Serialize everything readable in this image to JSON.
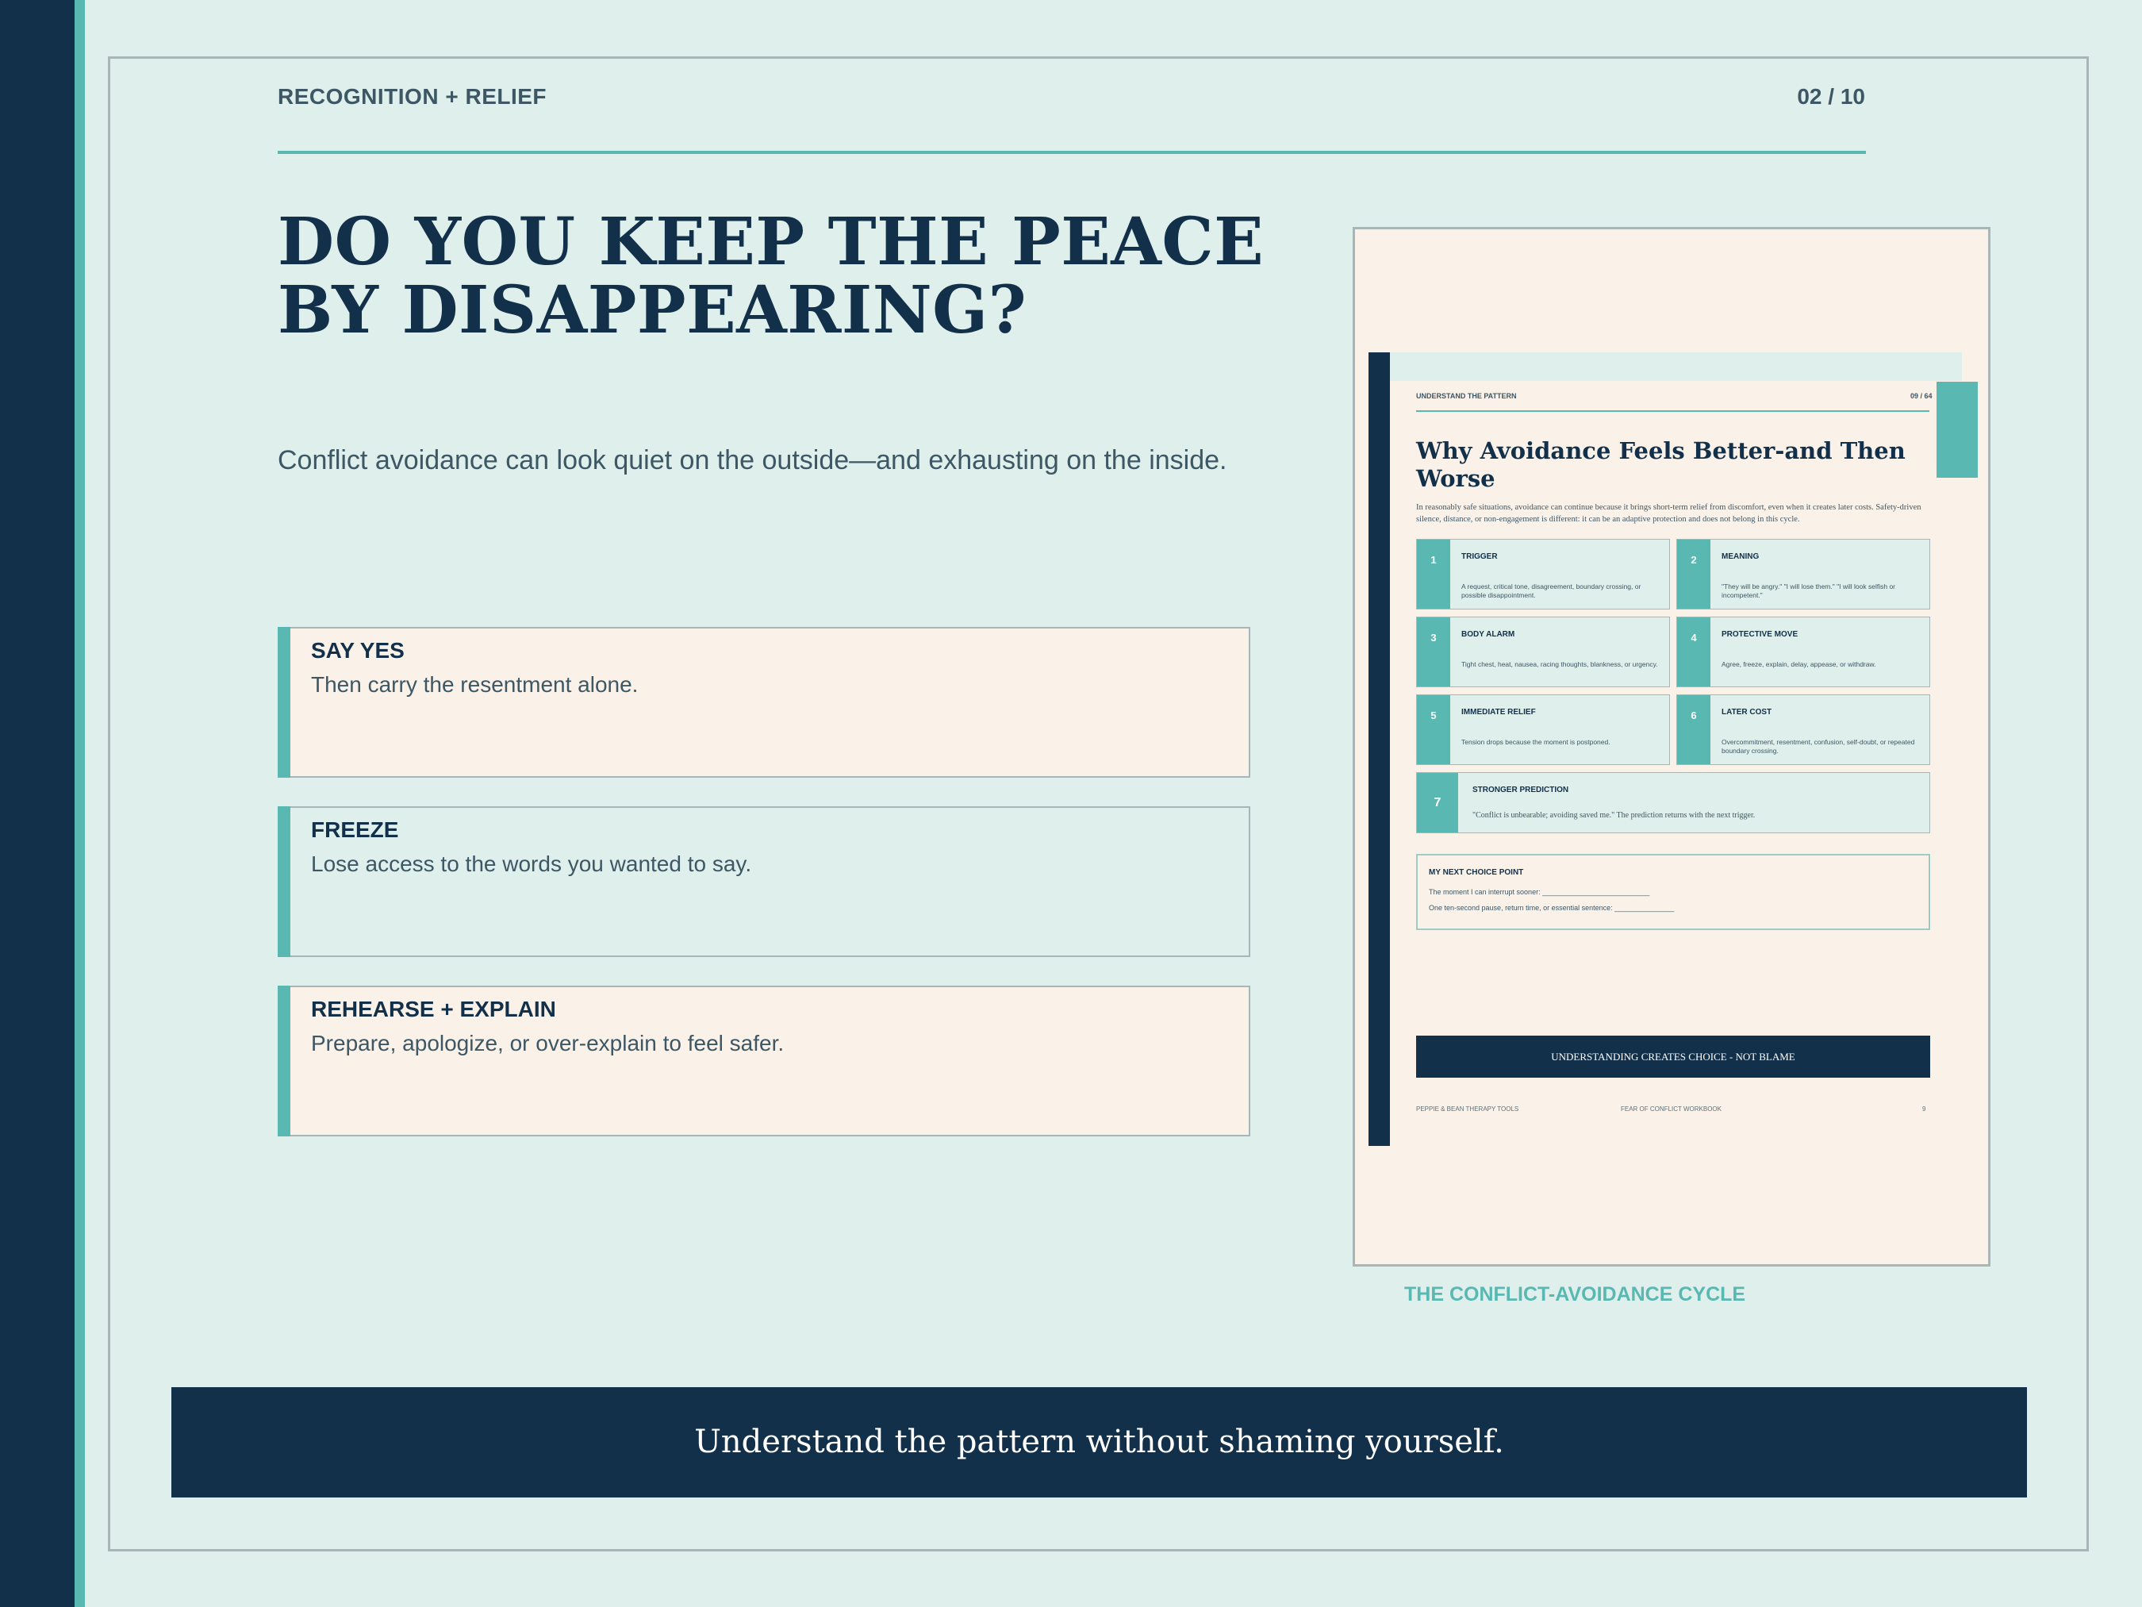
{
  "slide": {
    "eyebrow": "RECOGNITION + RELIEF",
    "page": "02 / 10",
    "title": "DO YOU KEEP THE PEACE BY DISAPPEARING?",
    "lede": "Conflict avoidance can look quiet on the outside—and exhausting on the inside.",
    "cards": [
      {
        "heading": "SAY YES",
        "text": "Then carry the resentment alone."
      },
      {
        "heading": "FREEZE",
        "text": "Lose access to the words you wanted to say."
      },
      {
        "heading": "REHEARSE + EXPLAIN",
        "text": "Prepare, apologize, or over-explain to feel safer."
      }
    ],
    "caption": "THE CONFLICT-AVOIDANCE CYCLE",
    "footer": "Understand the pattern without shaming yourself."
  },
  "workbook": {
    "eyebrow": "UNDERSTAND THE PATTERN",
    "page": "09 / 64",
    "title": "Why Avoidance Feels Better-and Then Worse",
    "intro": "In reasonably safe situations, avoidance can continue because it brings short-term relief from discomfort, even when it creates later costs. Safety-driven silence, distance, or non-engagement is different: it can be an adaptive protection and does not belong in this cycle.",
    "steps": [
      {
        "num": "1",
        "title": "TRIGGER",
        "text": "A request, critical tone, disagreement, boundary crossing, or possible disappointment."
      },
      {
        "num": "2",
        "title": "MEANING",
        "text": "\"They will be angry.\" \"I will lose them.\" \"I will look selfish or incompetent.\""
      },
      {
        "num": "3",
        "title": "BODY ALARM",
        "text": "Tight chest, heat, nausea, racing thoughts, blankness, or urgency."
      },
      {
        "num": "4",
        "title": "PROTECTIVE MOVE",
        "text": "Agree, freeze, explain, delay, appease, or withdraw."
      },
      {
        "num": "5",
        "title": "IMMEDIATE RELIEF",
        "text": "Tension drops because the moment is postponed."
      },
      {
        "num": "6",
        "title": "LATER COST",
        "text": "Overcommitment, resentment, confusion, self-doubt, or repeated boundary crossing."
      },
      {
        "num": "7",
        "title": "STRONGER PREDICTION",
        "text": "\"Conflict is unbearable; avoiding saved me.\" The prediction returns with the next trigger."
      }
    ],
    "choice": {
      "title": "MY NEXT CHOICE POINT",
      "line1": "The moment I can interrupt sooner: ___________________________",
      "line2": "One ten-second pause, return time, or essential sentence: _______________"
    },
    "banner": "UNDERSTANDING CREATES CHOICE - NOT BLAME",
    "footer": {
      "left": "PEPPIE & BEAN THERAPY TOOLS",
      "center": "FEAR OF CONFLICT WORKBOOK",
      "right": "9"
    }
  }
}
